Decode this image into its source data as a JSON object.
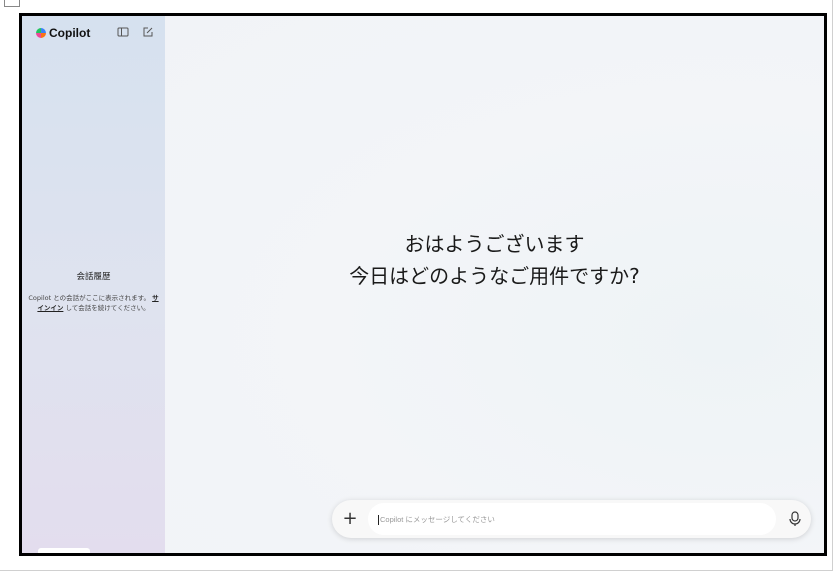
{
  "app": {
    "name": "Copilot"
  },
  "sidebar": {
    "history_title": "会話履歴",
    "history_text_before": "Copilot との会話がここに表示されます。",
    "history_link": "サインイン",
    "history_text_after": "して会話を続けてください。",
    "icons": [
      "sidebar-toggle-icon",
      "new-chat-icon"
    ]
  },
  "main": {
    "greeting_line1": "おはようございます",
    "greeting_line2": "今日はどのようなご用件ですか?"
  },
  "composer": {
    "placeholder": "Copilot にメッセージしてください",
    "plus_label": "+",
    "icons": [
      "plus-icon",
      "microphone-icon"
    ]
  },
  "colors": {
    "frame_border": "#000000",
    "sidebar_top": "#d6e1ef",
    "sidebar_bottom": "#e3ddee",
    "main_bg": "#f2f5f8"
  }
}
